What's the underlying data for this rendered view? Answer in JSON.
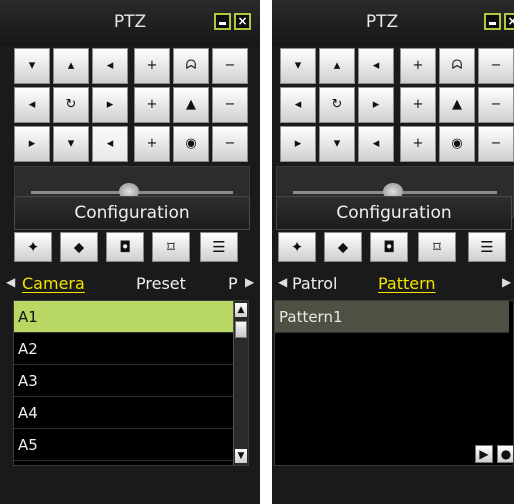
{
  "left": {
    "title": "PTZ",
    "grid": [
      [
        "▾",
        "▴",
        "◂",
        "+",
        "ᗣ",
        "−"
      ],
      [
        "◂",
        "↻",
        "▸",
        "+",
        "▲",
        "−"
      ],
      [
        "▸",
        "▾",
        "◂",
        "+",
        "◉",
        "−"
      ]
    ],
    "config_label": "Configuration",
    "toolbar": [
      "✦",
      "⬥",
      "◘",
      "⌑",
      "☰"
    ],
    "tabs": {
      "tab1": "Camera",
      "tab2": "Preset",
      "tab3": "P"
    },
    "list": [
      "A1",
      "A2",
      "A3",
      "A4",
      "A5"
    ],
    "selected_index": 0
  },
  "right": {
    "title": "PTZ",
    "grid": [
      [
        "▾",
        "▴",
        "◂",
        "+",
        "ᗣ",
        "−"
      ],
      [
        "◂",
        "↻",
        "▸",
        "+",
        "▲",
        "−"
      ],
      [
        "▸",
        "▾",
        "◂",
        "+",
        "◉",
        "−"
      ]
    ],
    "config_label": "Configuration",
    "toolbar": [
      "✦",
      "⬥",
      "◘",
      "⌑",
      "☰"
    ],
    "tabs": {
      "tab1": "Patrol",
      "tab2": "Pattern"
    },
    "list": [
      "Pattern1"
    ],
    "selected_index": 0,
    "pattern_buttons": [
      "▶",
      "●"
    ]
  },
  "icons": {
    "minimize": "minimize-icon",
    "close": "close-icon",
    "left_arrow": "chevron-left-icon",
    "right_arrow": "chevron-right-icon",
    "scroll_up": "scroll-up-icon",
    "scroll_down": "scroll-down-icon"
  },
  "colors": {
    "accent": "#b5c63e",
    "tab_active": "#f3e400",
    "row_selected": "#b9d863"
  }
}
